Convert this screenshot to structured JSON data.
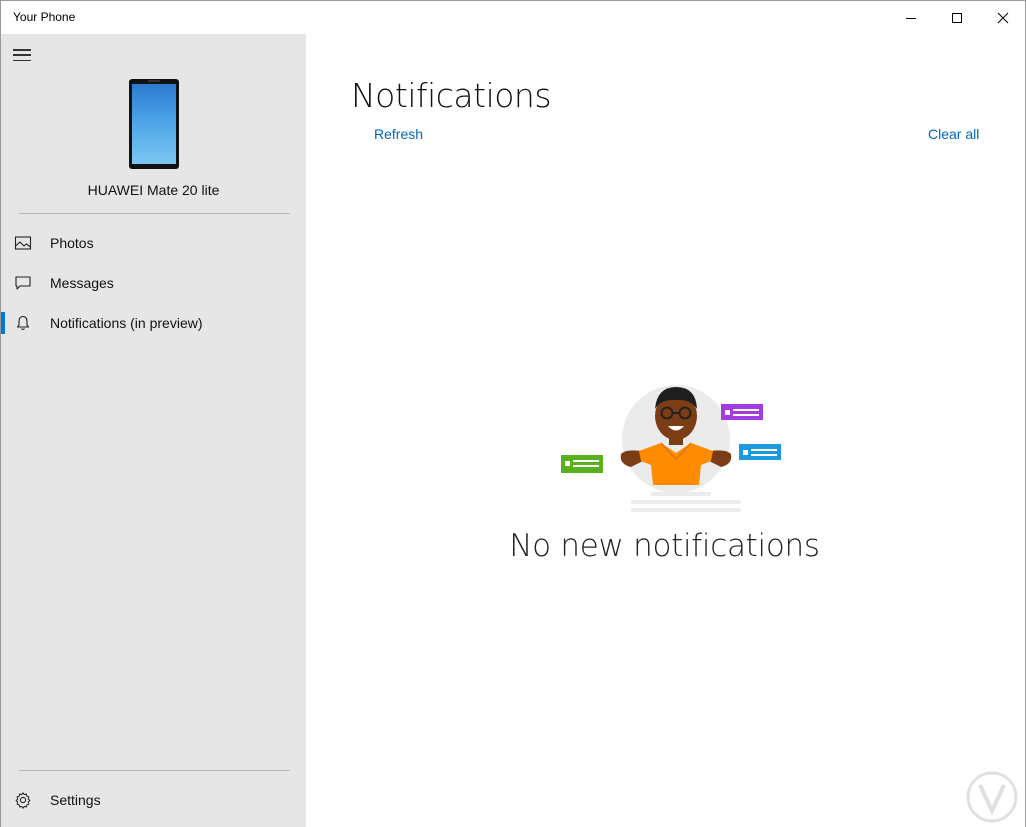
{
  "window": {
    "title": "Your Phone"
  },
  "sidebar": {
    "device_name": "HUAWEI Mate 20 lite",
    "items": [
      {
        "label": "Photos",
        "icon": "photos-icon"
      },
      {
        "label": "Messages",
        "icon": "messages-icon"
      },
      {
        "label": "Notifications (in preview)",
        "icon": "bell-icon",
        "active": true
      }
    ],
    "settings": {
      "label": "Settings",
      "icon": "gear-icon"
    }
  },
  "main": {
    "title": "Notifications",
    "refresh_label": "Refresh",
    "clear_all_label": "Clear all",
    "empty_message": "No new notifications"
  },
  "colors": {
    "accent": "#0078d7",
    "link": "#0067b8",
    "sidebar_bg": "#e6e6e6",
    "shirt": "#ff8c00",
    "card_green": "#5bb11d",
    "card_purple": "#a33be0",
    "card_blue": "#1b9ae0"
  }
}
